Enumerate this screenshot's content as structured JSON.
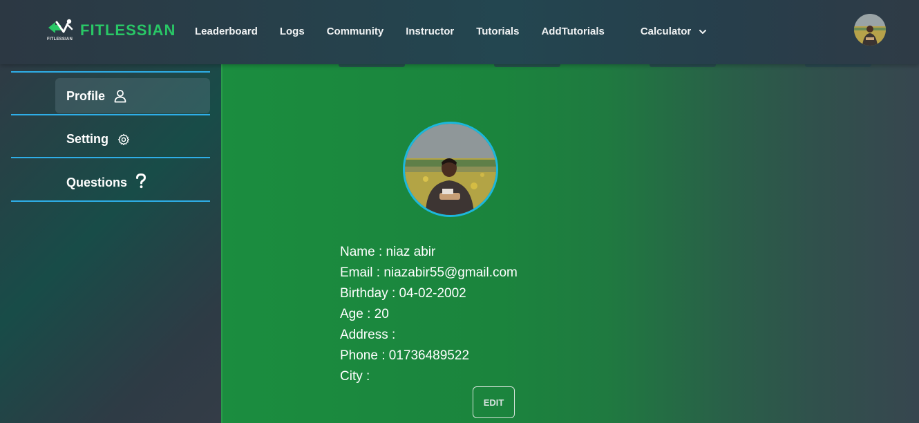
{
  "brand": {
    "name": "FITLESSIAN",
    "logo_subtext": "FITLESSIAN",
    "accent": "#29c766"
  },
  "nav": {
    "links": [
      "Leaderboard",
      "Logs",
      "Community",
      "Instructor",
      "Tutorials",
      "AddTutorials"
    ],
    "calculator": "Calculator",
    "calculator_icon": "chevron-down-icon",
    "avatar": "user-avatar"
  },
  "sidebar": {
    "items": [
      {
        "label": "Profile",
        "icon": "user-icon",
        "active": true
      },
      {
        "label": "Setting",
        "icon": "gear-icon",
        "active": false
      },
      {
        "label": "Questions",
        "icon": "question-icon",
        "active": false
      }
    ],
    "border_color": "#2eaee8"
  },
  "profile": {
    "name": "Name : niaz abir",
    "email": "Email : niazabir55@gmail.com",
    "birthday": "Birthday : 04-02-2002",
    "age": "Age : 20",
    "address": "Address :",
    "phone": "Phone : 01736489522",
    "city": "City :",
    "edit_label": "EDIT",
    "photo_border": "#1cb7dd"
  }
}
